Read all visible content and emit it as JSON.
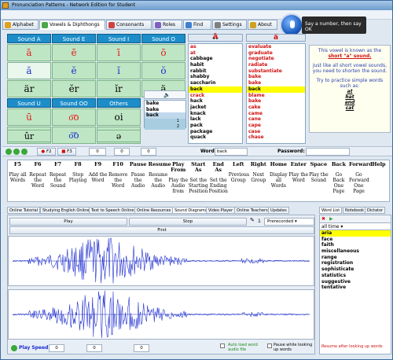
{
  "window": {
    "title": "Pronunciation Patterns  -  Network Edition for Student"
  },
  "top_tabs": [
    {
      "label": "Alphabet",
      "color": "#e0a020"
    },
    {
      "label": "Vowels & Diphthongs",
      "color": "#4aa84a"
    },
    {
      "label": "Consonants",
      "color": "#d04040"
    },
    {
      "label": "Roles",
      "color": "#8060c0"
    },
    {
      "label": "Find",
      "color": "#4080d0"
    },
    {
      "label": "Settings",
      "color": "#808080"
    },
    {
      "label": "About",
      "color": "#d0a020"
    }
  ],
  "tooltip": "Say a number, then say OK",
  "vowels": {
    "headers_top": [
      "Sound A",
      "Sound E",
      "Sound I",
      "Sound O"
    ],
    "row1": [
      "ā",
      "ē",
      "ī",
      "ō"
    ],
    "row2": [
      "ă",
      "ĕ",
      "ĭ",
      "ŏ"
    ],
    "row3": [
      "är",
      "ĕr",
      "ĭr",
      "ä"
    ],
    "headers_bottom": [
      "Sound U",
      "Sound OO",
      "Others"
    ],
    "row4": [
      "ū",
      "o͞o",
      "oi"
    ],
    "row5": [
      "ŭ",
      "o͝o",
      "oy"
    ],
    "row6": [
      "ûr",
      "",
      "ə"
    ]
  },
  "mini_list": {
    "items": [
      "bake",
      "bake",
      "back"
    ],
    "counter": [
      "1",
      "2"
    ]
  },
  "left_word_header": "ā",
  "right_word_header": "ă",
  "left_words": [
    "as",
    "at",
    "cabbage",
    "habit",
    "rabbit",
    "shabby",
    "saccharin",
    "back",
    "crack",
    "hack",
    "jacket",
    "knack",
    "lack",
    "pack",
    "package",
    "quack"
  ],
  "left_highlight": "back",
  "right_words": [
    "evaluate",
    "graduate",
    "negotiate",
    "radiate",
    "substantiate",
    "bake",
    "bake",
    "back",
    "blame",
    "bake",
    "cake",
    "came",
    "cane",
    "cape",
    "case",
    "chase"
  ],
  "right_highlight": "back",
  "info": {
    "line1": "This vowel is known as the",
    "bold": "short \"a\" sound.",
    "line2": "Just like all short vowel sounds, you need to shorten the sound.",
    "line3": "Try to practice simple words such as:",
    "examples": [
      "at",
      "hat",
      "and",
      "cat"
    ]
  },
  "toolbar": {
    "word_label": "Word:",
    "word_value": "back",
    "password_label": "Password:",
    "f2": "F2",
    "f3": "F3",
    "counter_a": "0",
    "counter_b": "0",
    "counter_c": "0"
  },
  "fkeys": [
    {
      "k": "F5",
      "t": "Play all Words"
    },
    {
      "k": "F6",
      "t": "Repeat the Word"
    },
    {
      "k": "F7",
      "t": "Repeat the Sound"
    },
    {
      "k": "F8",
      "t": "Stop Playing"
    },
    {
      "k": "F9",
      "t": "Add the Word"
    },
    {
      "k": "F10",
      "t": "Remove the Word"
    },
    {
      "k": "Pause",
      "t": "Pause the Audio"
    },
    {
      "k": "Resume",
      "t": "Resume the Audio"
    },
    {
      "k": "Play From",
      "t": "Play the Audio from"
    },
    {
      "k": "Start As",
      "t": "Set the Starting Position"
    },
    {
      "k": "End As",
      "t": "Set the Ending Position"
    },
    {
      "k": "Left",
      "t": "Previous Group"
    },
    {
      "k": "Right",
      "t": "Next Group"
    },
    {
      "k": "Home",
      "t": "Display all Words"
    },
    {
      "k": "Enter",
      "t": "Play the Word"
    },
    {
      "k": "Space",
      "t": "Play the Sound"
    },
    {
      "k": "Back",
      "t": "Go Back One Page"
    },
    {
      "k": "Forward",
      "t": "Go Forward One Page"
    },
    {
      "k": "Help",
      "t": ""
    }
  ],
  "lower_tabs": [
    "Online Tutorial",
    "Studying English Online",
    "Text to Speech Online",
    "Online Resources",
    "Sound Diagrams",
    "Video Player",
    "Online Teachers",
    "Updates"
  ],
  "right_tabs": [
    "Word List",
    "Notebook",
    "Dictator"
  ],
  "sound": {
    "play_label": "Play",
    "stop_label": "Stop",
    "first_label": "First",
    "prerecorded": "Prerecorded",
    "record_count": "1",
    "play_speed_label": "Play Speed",
    "speed_value": "0",
    "auto_load": "Auto load word audio file",
    "pause_look": "Pause while looking up words",
    "resume_look": "Resume after looking up words"
  },
  "side_list": {
    "filter": "all time",
    "items": [
      "aria",
      "face",
      "faith",
      "miscellaneous",
      "range",
      "registration",
      "sophisticate",
      "statistics",
      "suggestive",
      "tentative"
    ],
    "highlight": "aria"
  }
}
